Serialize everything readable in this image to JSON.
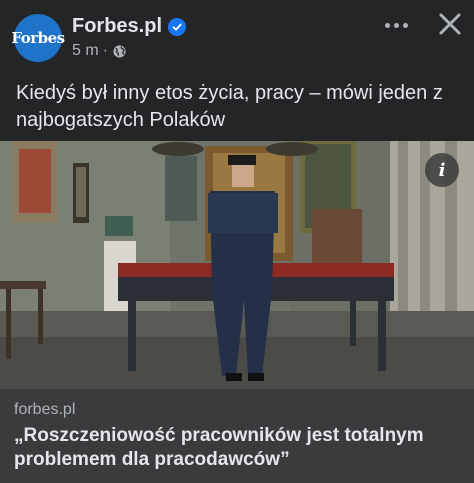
{
  "post": {
    "page_name": "Forbes.pl",
    "avatar_text": "Forbes",
    "timestamp": "5 m",
    "separator": "·",
    "audience_icon": "globe-icon",
    "text": "Kiedyś był inny etos życia, pracy – mówi jeden z najbogatszych Polaków"
  },
  "link": {
    "domain": "forbes.pl",
    "title": "„Roszczeniowość pracowników jest totalnym problemem dla pracodawców”"
  },
  "icons": {
    "more": "more-dots-icon",
    "close": "close-icon",
    "info": "info-icon",
    "verified": "verified-badge-icon"
  },
  "info_label": "i",
  "colors": {
    "background": "#242526",
    "link_card": "#3a3b3c",
    "accent": "#1877f2",
    "avatar": "#1f73c9"
  }
}
